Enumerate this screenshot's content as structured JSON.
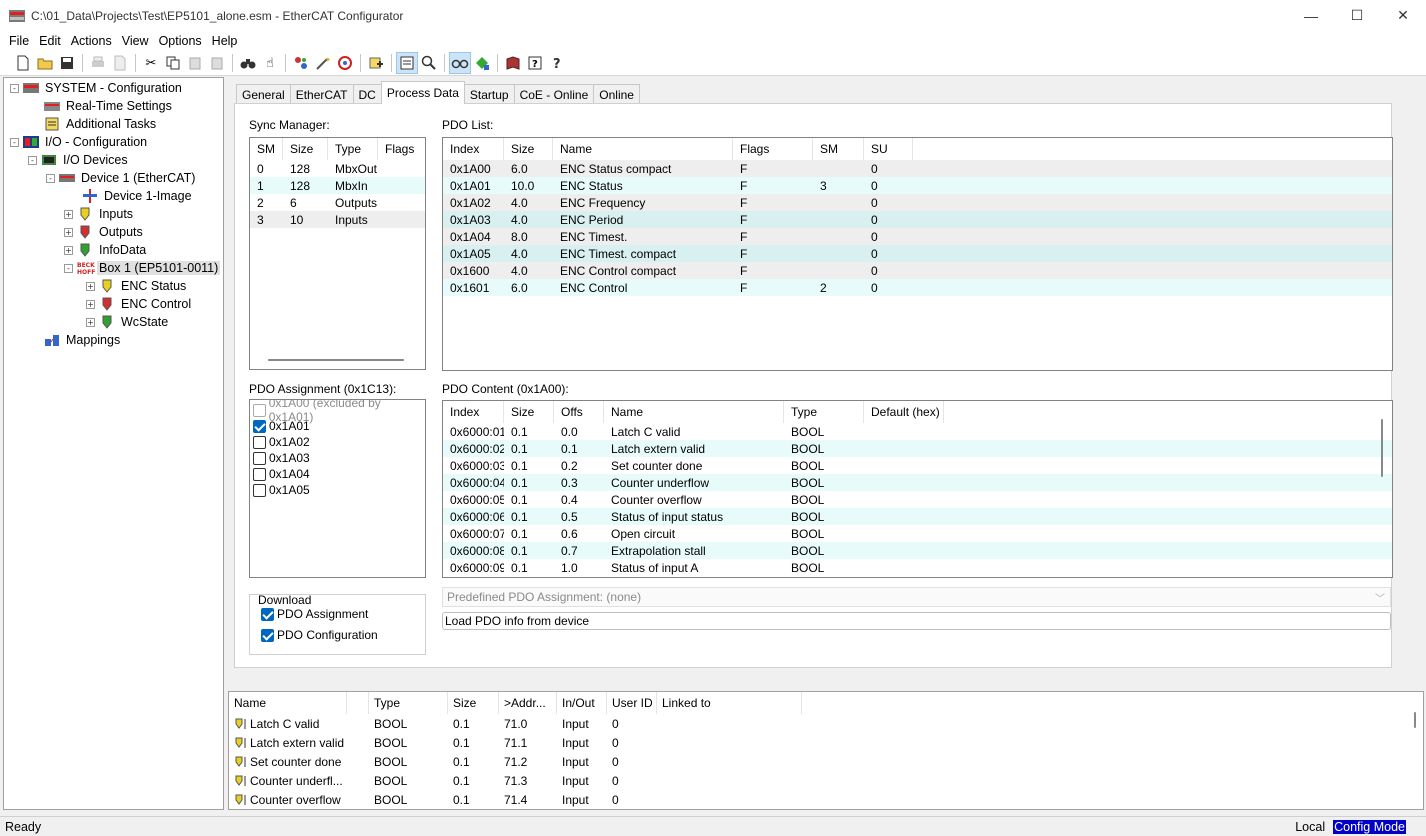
{
  "window": {
    "title": "C:\\01_Data\\Projects\\Test\\EP5101_alone.esm - EtherCAT Configurator",
    "minimize": "—",
    "maximize": "☐",
    "close": "✕"
  },
  "menu": [
    {
      "label": "File"
    },
    {
      "label": "Edit"
    },
    {
      "label": "Actions"
    },
    {
      "label": "View"
    },
    {
      "label": "Options"
    },
    {
      "label": "Help"
    }
  ],
  "toolbar": {
    "icons": [
      "new-icon",
      "open-icon",
      "save-icon",
      "print-icon",
      "print-preview-icon",
      "cut-icon",
      "copy-icon",
      "paste-icon",
      "paste-special-icon",
      "find-icon",
      "hand-icon",
      "scan-icon",
      "wand-icon",
      "target-icon",
      "add-device-icon",
      "list-view-icon",
      "zoom-icon",
      "glasses-icon",
      "online-icon",
      "book-icon",
      "help-context-icon",
      "help-icon"
    ]
  },
  "tree": [
    {
      "label": "SYSTEM - Configuration",
      "level": 0,
      "expander": "-"
    },
    {
      "label": "Real-Time Settings",
      "level": 1,
      "expander": ""
    },
    {
      "label": "Additional Tasks",
      "level": 1,
      "expander": ""
    },
    {
      "label": "I/O - Configuration",
      "level": 0,
      "expander": "-"
    },
    {
      "label": "I/O Devices",
      "level": 1,
      "expander": "-"
    },
    {
      "label": "Device 1 (EtherCAT)",
      "level": 2,
      "expander": "-"
    },
    {
      "label": "Device 1-Image",
      "level": 3,
      "expander": ""
    },
    {
      "label": "Inputs",
      "level": 3,
      "expander": "+"
    },
    {
      "label": "Outputs",
      "level": 3,
      "expander": "+"
    },
    {
      "label": "InfoData",
      "level": 3,
      "expander": "+"
    },
    {
      "label": "Box 1 (EP5101-0011)",
      "level": 3,
      "expander": "-",
      "selected": true
    },
    {
      "label": "ENC Status",
      "level": 4,
      "expander": "+"
    },
    {
      "label": "ENC Control",
      "level": 4,
      "expander": "+"
    },
    {
      "label": "WcState",
      "level": 4,
      "expander": "+"
    },
    {
      "label": "Mappings",
      "level": 1,
      "expander": ""
    }
  ],
  "tabs": [
    {
      "label": "General"
    },
    {
      "label": "EtherCAT"
    },
    {
      "label": "DC"
    },
    {
      "label": "Process Data",
      "active": true
    },
    {
      "label": "Startup"
    },
    {
      "label": "CoE - Online"
    },
    {
      "label": "Online"
    }
  ],
  "sync_manager": {
    "label": "Sync Manager:",
    "columns": [
      "SM",
      "Size",
      "Type",
      "Flags"
    ],
    "rows": [
      [
        "0",
        "128",
        "MbxOut",
        ""
      ],
      [
        "1",
        "128",
        "MbxIn",
        ""
      ],
      [
        "2",
        "6",
        "Outputs",
        ""
      ],
      [
        "3",
        "10",
        "Inputs",
        ""
      ]
    ]
  },
  "pdo_list": {
    "label": "PDO List:",
    "columns": [
      "Index",
      "Size",
      "Name",
      "Flags",
      "SM",
      "SU"
    ],
    "rows": [
      [
        "0x1A00",
        "6.0",
        "ENC Status compact",
        "F",
        "",
        "0"
      ],
      [
        "0x1A01",
        "10.0",
        "ENC Status",
        "F",
        "3",
        "0"
      ],
      [
        "0x1A02",
        "4.0",
        "ENC Frequency",
        "F",
        "",
        "0"
      ],
      [
        "0x1A03",
        "4.0",
        "ENC Period",
        "F",
        "",
        "0"
      ],
      [
        "0x1A04",
        "8.0",
        "ENC Timest.",
        "F",
        "",
        "0"
      ],
      [
        "0x1A05",
        "4.0",
        "ENC Timest. compact",
        "F",
        "",
        "0"
      ],
      [
        "0x1600",
        "4.0",
        "ENC Control compact",
        "F",
        "",
        "0"
      ],
      [
        "0x1601",
        "6.0",
        "ENC Control",
        "F",
        "2",
        "0"
      ]
    ]
  },
  "pdo_assignment": {
    "label": "PDO Assignment (0x1C13):",
    "items": [
      {
        "label": "0x1A00 (excluded by 0x1A01)",
        "checked": false,
        "disabled": true
      },
      {
        "label": "0x1A01",
        "checked": true,
        "disabled": false
      },
      {
        "label": "0x1A02",
        "checked": false,
        "disabled": false
      },
      {
        "label": "0x1A03",
        "checked": false,
        "disabled": false
      },
      {
        "label": "0x1A04",
        "checked": false,
        "disabled": false
      },
      {
        "label": "0x1A05",
        "checked": false,
        "disabled": false
      }
    ]
  },
  "pdo_content": {
    "label": "PDO Content (0x1A00):",
    "columns": [
      "Index",
      "Size",
      "Offs",
      "Name",
      "Type",
      "Default (hex)"
    ],
    "rows": [
      [
        "0x6000:01",
        "0.1",
        "0.0",
        "Latch C valid",
        "BOOL",
        ""
      ],
      [
        "0x6000:02",
        "0.1",
        "0.1",
        "Latch extern valid",
        "BOOL",
        ""
      ],
      [
        "0x6000:03",
        "0.1",
        "0.2",
        "Set counter done",
        "BOOL",
        ""
      ],
      [
        "0x6000:04",
        "0.1",
        "0.3",
        "Counter underflow",
        "BOOL",
        ""
      ],
      [
        "0x6000:05",
        "0.1",
        "0.4",
        "Counter overflow",
        "BOOL",
        ""
      ],
      [
        "0x6000:06",
        "0.1",
        "0.5",
        "Status of input status",
        "BOOL",
        ""
      ],
      [
        "0x6000:07",
        "0.1",
        "0.6",
        "Open circuit",
        "BOOL",
        ""
      ],
      [
        "0x6000:08",
        "0.1",
        "0.7",
        "Extrapolation stall",
        "BOOL",
        ""
      ],
      [
        "0x6000:09",
        "0.1",
        "1.0",
        "Status of input A",
        "BOOL",
        ""
      ]
    ]
  },
  "download": {
    "label": "Download",
    "pdo_assignment": "PDO Assignment",
    "pdo_configuration": "PDO Configuration"
  },
  "predefined": {
    "value": "Predefined PDO Assignment: (none)"
  },
  "load_button": "Load PDO info from device",
  "variables": {
    "columns": [
      "Name",
      "",
      "Type",
      "Size",
      ">Addr...",
      "In/Out",
      "User ID",
      "Linked to"
    ],
    "rows": [
      [
        "Latch C valid",
        "BOOL",
        "0.1",
        "71.0",
        "Input",
        "0",
        ""
      ],
      [
        "Latch extern valid",
        "BOOL",
        "0.1",
        "71.1",
        "Input",
        "0",
        ""
      ],
      [
        "Set counter done",
        "BOOL",
        "0.1",
        "71.2",
        "Input",
        "0",
        ""
      ],
      [
        "Counter underfl...",
        "BOOL",
        "0.1",
        "71.3",
        "Input",
        "0",
        ""
      ],
      [
        "Counter overflow",
        "BOOL",
        "0.1",
        "71.4",
        "Input",
        "0",
        ""
      ]
    ]
  },
  "status": {
    "left": "Ready",
    "location": "Local",
    "mode": "Config Mode"
  },
  "colors": {
    "selection_blue": "#0067c0",
    "row_highlight": "#e8fbfb",
    "status_mode_bg": "#0000c8"
  }
}
